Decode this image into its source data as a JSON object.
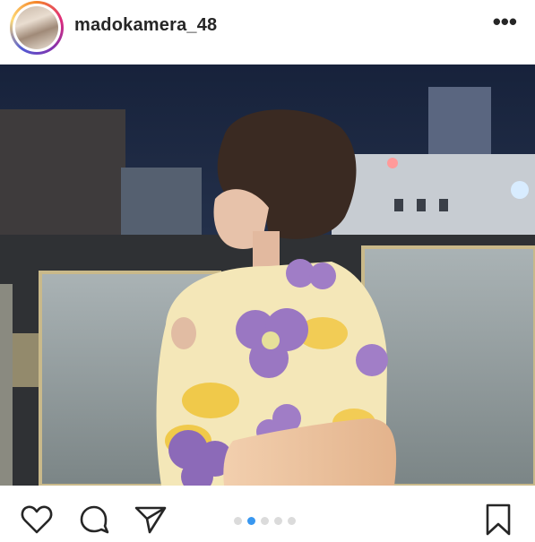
{
  "post": {
    "username": "madokamera_48",
    "more_icon": "more-horizontal-icon",
    "carousel": {
      "count": 5,
      "active_index": 1
    }
  },
  "actions": {
    "like_icon": "heart-icon",
    "comment_icon": "comment-icon",
    "share_icon": "send-icon",
    "save_icon": "bookmark-icon"
  },
  "colors": {
    "accent": "#3897f0",
    "text": "#262626",
    "inactive_dot": "#dbdbdb"
  }
}
